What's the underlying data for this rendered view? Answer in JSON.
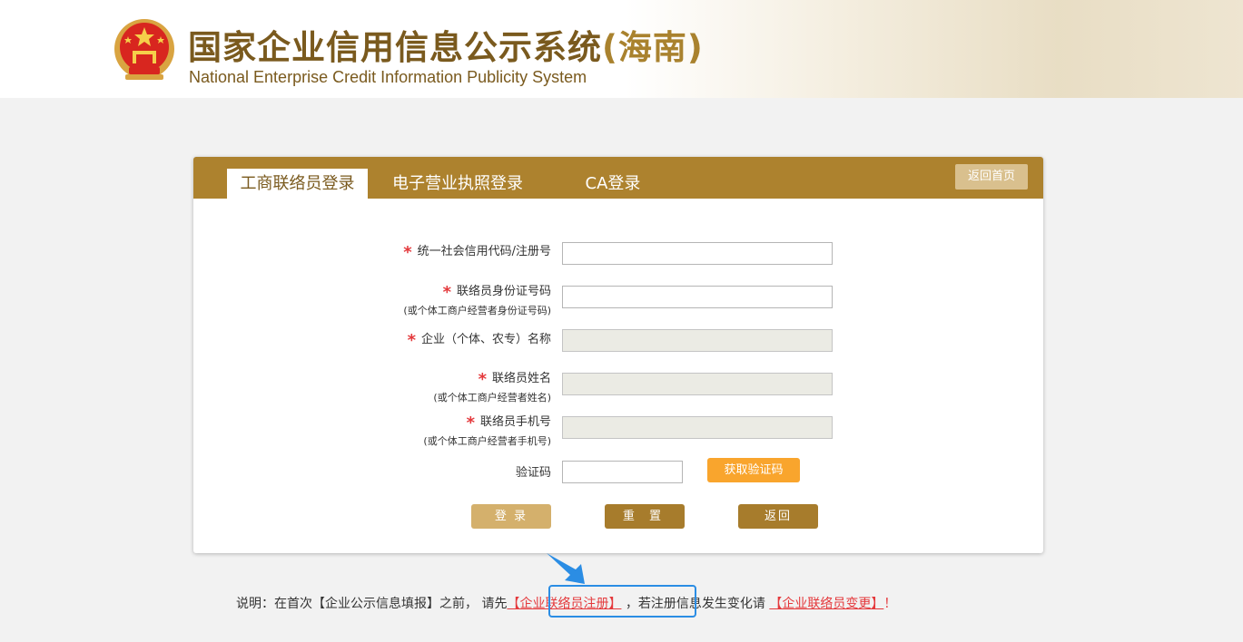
{
  "header": {
    "title_main": "国家企业信用信息公示系统",
    "title_region": "(海南)",
    "title_en": "National Enterprise Credit Information Publicity System"
  },
  "tabs": [
    {
      "label": "工商联络员登录",
      "active": true
    },
    {
      "label": "电子营业执照登录",
      "active": false
    },
    {
      "label": "CA登录",
      "active": false
    }
  ],
  "home_button": "返回首页",
  "form": {
    "fields": [
      {
        "label": "统一社会信用代码/注册号",
        "sub": "",
        "required": true,
        "value": "",
        "disabled": false
      },
      {
        "label": "联络员身份证号码",
        "sub": "(或个体工商户经营者身份证号码)",
        "required": true,
        "value": "",
        "disabled": false
      },
      {
        "label": "企业（个体、农专）名称",
        "sub": "",
        "required": true,
        "value": "",
        "disabled": true
      },
      {
        "label": "联络员姓名",
        "sub": "(或个体工商户经营者姓名)",
        "required": true,
        "value": "",
        "disabled": true
      },
      {
        "label": "联络员手机号",
        "sub": "(或个体工商户经营者手机号)",
        "required": true,
        "value": "",
        "disabled": true
      }
    ],
    "captcha_label": "验证码",
    "captcha_value": "",
    "get_code_button": "获取验证码",
    "login_button": "登 录",
    "reset_button": "重 置",
    "back_button": "返回",
    "required_mark": "*"
  },
  "note": {
    "prefix": "说明：在首次【企业公示信息填报】之前， 请先",
    "register_link": "【企业联络员注册】",
    "middle": " ，若注册信息发生变化请 ",
    "change_link": "【企业联络员变更】",
    "suffix": "！"
  },
  "colors": {
    "brand_gold": "#ad822e",
    "accent_orange": "#f9a52d",
    "required_red": "#e4393c",
    "highlight_blue": "#2b8de4"
  }
}
